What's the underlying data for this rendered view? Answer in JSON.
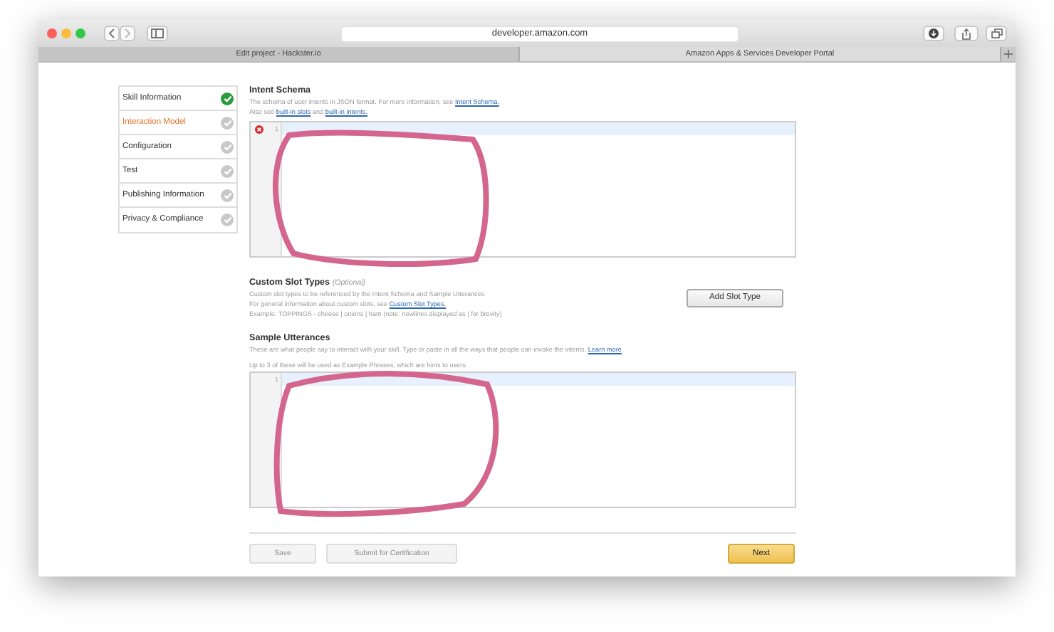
{
  "browser": {
    "address": "developer.amazon.com",
    "tabs": [
      {
        "title": "Edit project - Hackster.io",
        "selected": false
      },
      {
        "title": "Amazon Apps & Services Developer Portal",
        "selected": true
      }
    ]
  },
  "steps": [
    {
      "label": "Skill Information",
      "selected": false,
      "completed": true
    },
    {
      "label": "Interaction Model",
      "selected": true,
      "completed": false
    },
    {
      "label": "Configuration",
      "selected": false,
      "completed": false
    },
    {
      "label": "Test",
      "selected": false,
      "completed": false
    },
    {
      "label": "Publishing Information",
      "selected": false,
      "completed": false
    },
    {
      "label": "Privacy & Compliance",
      "selected": false,
      "completed": false
    }
  ],
  "intent_schema": {
    "title": "Intent Schema",
    "lines": [
      [
        {
          "kind": "text",
          "text": "The schema of user intents in JSON format. For more information, see "
        },
        {
          "kind": "link",
          "text": "Intent Schema."
        }
      ],
      [
        {
          "kind": "text",
          "text": "Also see "
        },
        {
          "kind": "link",
          "text": "built-in slots"
        },
        {
          "kind": "text",
          "text": " and "
        },
        {
          "kind": "link",
          "text": "built-in intents."
        }
      ]
    ],
    "editor": {
      "line_number": "1",
      "has_error": true
    }
  },
  "custom_slot_types": {
    "title": "Custom Slot Types",
    "note": "(Optional)",
    "lines": [
      [
        {
          "kind": "text",
          "text": "Custom slot types to be referenced by the Intent Schema and Sample Utterances"
        }
      ],
      [
        {
          "kind": "text",
          "text": "For general information about custom slots, see "
        },
        {
          "kind": "link",
          "text": "Custom Slot Types."
        }
      ],
      [
        {
          "kind": "text",
          "text": "Example: TOPPINGS - cheese | onions | ham (note: newlines displayed as | for brevity)"
        }
      ]
    ],
    "button": "Add Slot Type"
  },
  "sample_utterances": {
    "title": "Sample Utterances",
    "lines": [
      [
        {
          "kind": "text",
          "text": "These are what people say to interact with your skill. Type or paste in all the ways that people can invoke the intents. "
        },
        {
          "kind": "link",
          "text": "Learn more"
        }
      ],
      [
        {
          "kind": "text",
          "text": "Up to 3 of these will be used as Example Phrases, which are hints to users."
        }
      ]
    ],
    "editor": {
      "line_number": "1",
      "has_error": false
    }
  },
  "footer_buttons": [
    {
      "label": "Save",
      "kind": "secondary",
      "disabled": true
    },
    {
      "label": "Submit for Certification",
      "kind": "secondary",
      "disabled": true
    },
    {
      "label": "Next",
      "kind": "primary",
      "disabled": false
    }
  ]
}
